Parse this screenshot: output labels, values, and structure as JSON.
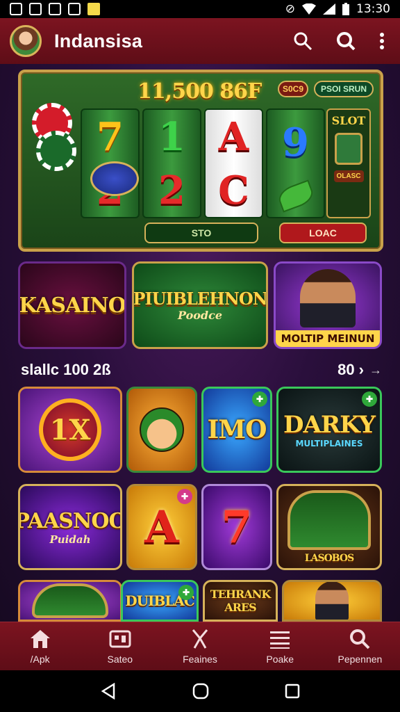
{
  "status_bar": {
    "time": "13:30",
    "left_icons": [
      "screenshot-icon",
      "image-icon",
      "photo-icon",
      "video-icon",
      "note-icon"
    ],
    "right_icons": [
      "mute-icon",
      "wifi-icon",
      "signal-icon",
      "battery-icon"
    ]
  },
  "app_bar": {
    "title": "Indansisa",
    "actions": [
      "search-icon",
      "search-alt-icon",
      "more-vert-icon"
    ]
  },
  "hero": {
    "jackpot": "11,500 86F",
    "pill_left": "S0C9",
    "pill_right": "PSOI SRUN",
    "side_logo": "SLOT",
    "side_badge": "OLASC",
    "spin_label": "STO",
    "load_label": "LOAC",
    "reels": [
      [
        "7",
        "2"
      ],
      [
        "1",
        "2"
      ],
      [
        "A",
        "C"
      ],
      [
        "9",
        "leaf"
      ]
    ]
  },
  "categories": [
    {
      "title": "KASAINO"
    },
    {
      "title": "PIUIBLEHNON",
      "subtitle": "Poodce"
    },
    {
      "title": "MOLTIP MEINUN"
    }
  ],
  "section": {
    "title": "slallc 100 2ß",
    "more": "80 ›",
    "arrow": "→"
  },
  "games_row1": [
    {
      "label": "1X",
      "sub": ""
    },
    {
      "label": "",
      "sub": ""
    },
    {
      "label": "IMO",
      "sub": ""
    },
    {
      "label": "DARKY",
      "sub": "MULTIPLAINES"
    }
  ],
  "games_row2": [
    {
      "label": "PAASNOO",
      "sub": "Puidah"
    },
    {
      "label": "A",
      "sub": ""
    },
    {
      "label": "7",
      "sub": ""
    },
    {
      "label": "LASOBOS",
      "sub": ""
    }
  ],
  "games_row3": [
    {
      "label": ""
    },
    {
      "label": "DUIBLAC"
    },
    {
      "label": "TEHRANK ARES"
    },
    {
      "label": ""
    }
  ],
  "bottom_nav": [
    {
      "label": "/Apk",
      "icon": "home-icon"
    },
    {
      "label": "Sateo",
      "icon": "games-icon"
    },
    {
      "label": "Feaines",
      "icon": "tools-icon"
    },
    {
      "label": "Poake",
      "icon": "list-icon"
    },
    {
      "label": "Pepennen",
      "icon": "search-icon"
    }
  ]
}
